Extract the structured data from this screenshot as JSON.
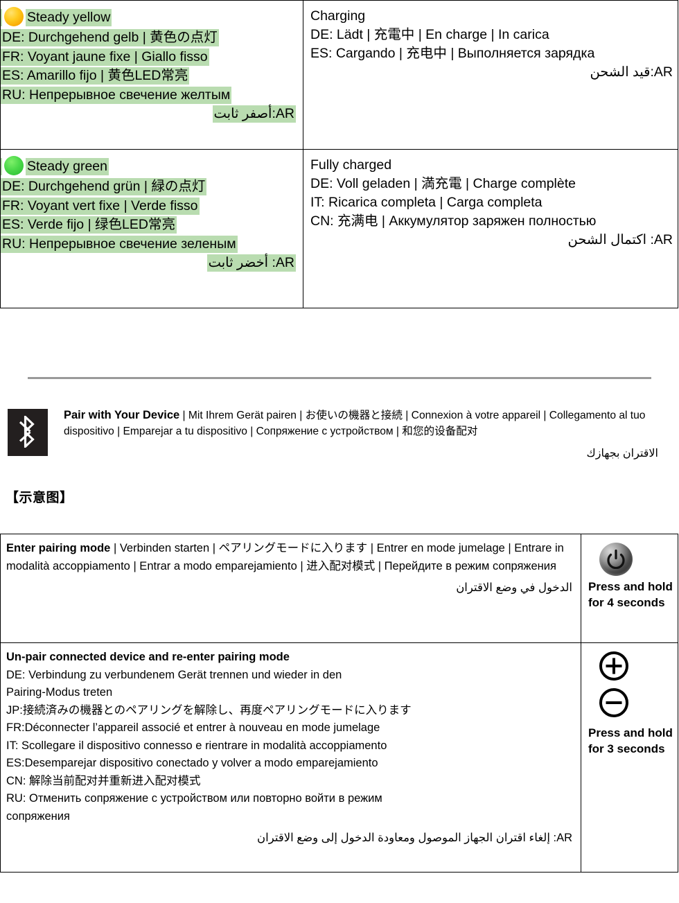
{
  "led_table": {
    "rows": [
      {
        "led": {
          "icon": "yellow-led-circle",
          "lines": [
            "Steady yellow",
            "DE: Durchgehend gelb | 黄色の点灯",
            "FR: Voyant jaune fixe | Giallo fisso",
            "ES: Amarillo fijo |  黄色LED常亮",
            "RU: Непрерывное свечение желтым"
          ],
          "ar": "AR:أصفر ثابت"
        },
        "desc": [
          "Charging",
          "DE: Lädt |  充電中 | En charge | In carica",
          "ES: Cargando | 充电中 |  Выполняется зарядка"
        ],
        "desc_ar": "AR:قيد الشحن"
      },
      {
        "led": {
          "icon": "green-led-circle",
          "lines": [
            "Steady green",
            "DE: Durchgehend grün | 緑の点灯",
            "FR: Voyant vert fixe | Verde fisso",
            "ES: Verde fijo | 绿色LED常亮",
            "RU: Непрерывное свечение зеленым"
          ],
          "ar": "AR: أخضر ثابت"
        },
        "desc": [
          "Fully charged",
          "DE: Voll geladen | 満充電 | Charge complète",
          "IT: Ricarica completa | Carga completa",
          "CN: 充满电 | Аккумулятор заряжен полностью"
        ],
        "desc_ar": "AR: اكتمال الشحن"
      }
    ]
  },
  "pair_header": {
    "icon": "bluetooth-icon",
    "title": "Pair with Your Device",
    "translations": " | Mit Ihrem Gerät pairen | お使いの機器と接続 | Connexion à votre appareil |  Collegamento al tuo dispositivo | Emparejar a tu dispositivo | Сопряжение с устройством | 和您的设备配对",
    "arabic": "الاقتران بجهازك",
    "cn_note": "【示意图】"
  },
  "pair_table": {
    "rows": [
      {
        "title": "Enter pairing mode",
        "body": " | Verbinden starten | ペアリングモードに入ります |  Entrer en mode jumelage | Entrare in modalità accoppiamento | Entrar a modo emparejamiento | 进入配对模式 | Перейдите в режим сопряжения",
        "arabic": "الدخول في وضع الاقتران",
        "button": {
          "icon": "power-button-icon",
          "label": "Press and hold for 4 seconds"
        }
      },
      {
        "title": "Un-pair connected device and re-enter pairing mode",
        "lines": [
          "DE: Verbindung zu verbundenem Gerät trennen und wieder in den",
          "Pairing-Modus treten",
          "JP:接続済みの機器とのペアリングを解除し、再度ペアリングモードに入ります",
          "FR:Déconnecter l’appareil associé et entrer à nouveau en mode jumelage",
          "IT: Scollegare il dispositivo connesso e rientrare in modalità accoppiamento",
          "ES:Desemparejar dispositivo conectado y volver a modo emparejamiento",
          "CN: 解除当前配对并重新进入配对模式",
          "RU: Отменить сопряжение с устройством или повторно войти в режим",
          "сопряжения"
        ],
        "arabic": "AR: إلغاء اقتران الجهاز الموصول ومعاودة الدخول إلى وضع الاقتران",
        "button": {
          "icon_plus": "plus-circle-icon",
          "icon_minus": "minus-circle-icon",
          "label": "Press and hold for 3 seconds"
        }
      }
    ]
  },
  "colors": {
    "highlight": "#b9dcb0",
    "rule": "#9a9a9a",
    "bluetooth_bg": "#231f1f"
  }
}
